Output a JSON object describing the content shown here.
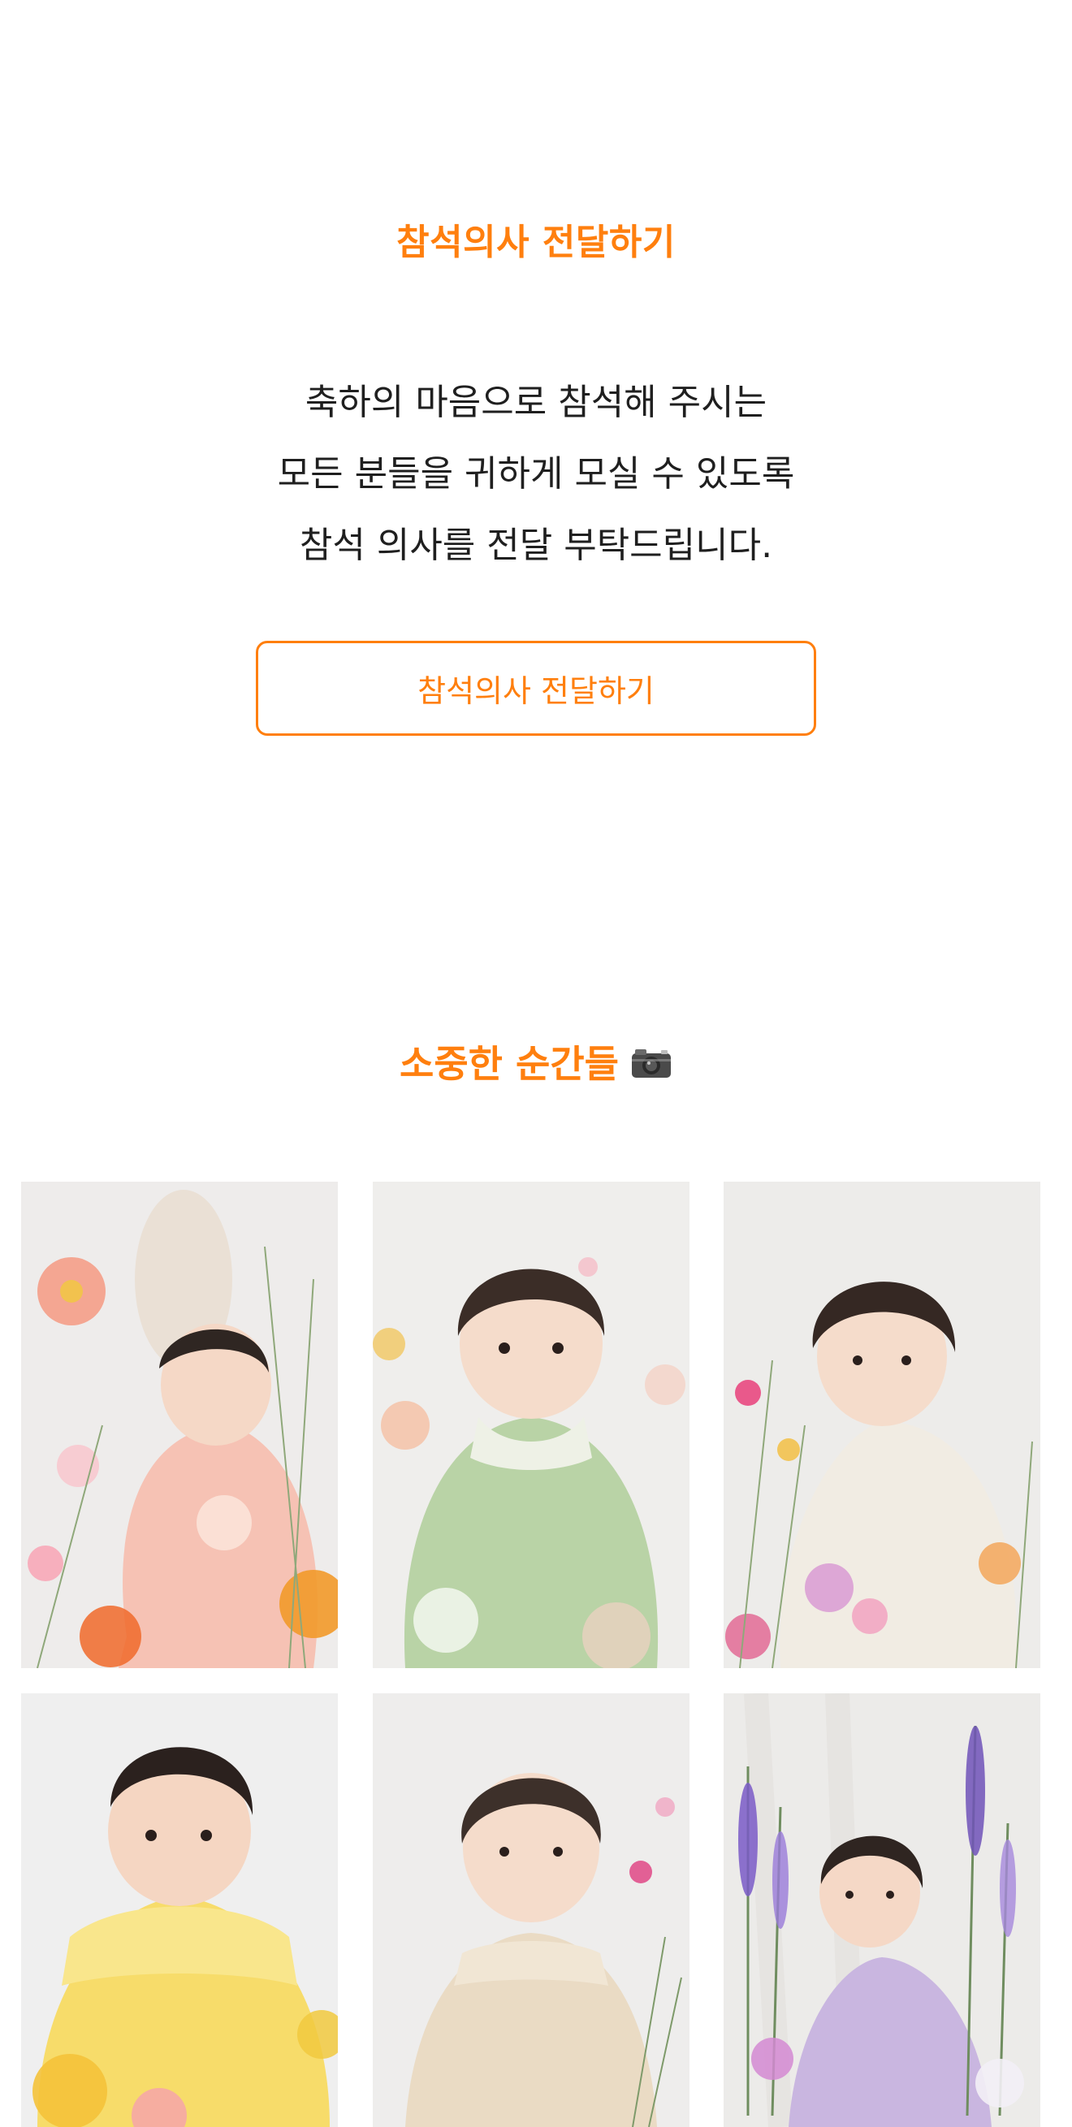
{
  "rsvp": {
    "title": "참석의사 전달하기",
    "message_lines": [
      "축하의 마음으로 참석해 주시는",
      "모든 분들을 귀하게 모실 수 있도록",
      "참석 의사를 전달 부탁드립니다."
    ],
    "button_label": "참석의사 전달하기",
    "accent_color": "#ff7f0e"
  },
  "gallery": {
    "title": "소중한 순간들",
    "title_icon": "camera-icon",
    "photos": [
      {
        "dress_color": "#f6c2b4"
      },
      {
        "dress_color": "#b9d3a6"
      },
      {
        "dress_color": "#f1ece3"
      },
      {
        "dress_color": "#f7dc6a"
      },
      {
        "dress_color": "#eadbc4"
      },
      {
        "dress_color": "#c9b6e0"
      }
    ]
  }
}
